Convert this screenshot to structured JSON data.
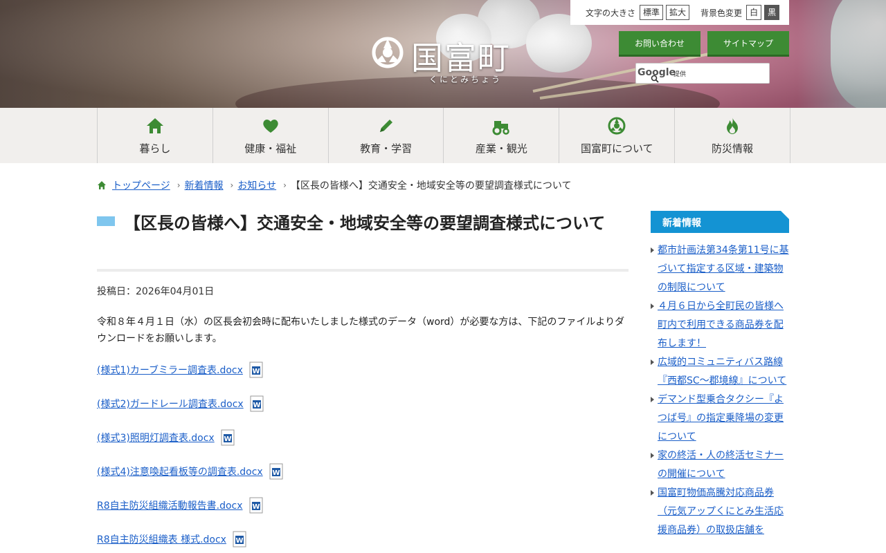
{
  "header": {
    "site_name": "国富町",
    "site_name_kana": "くにとみちょう",
    "text_size_label": "文字の大きさ",
    "text_size_standard": "標準",
    "text_size_large": "拡大",
    "bg_color_label": "背景色変更",
    "bg_white": "白",
    "bg_black": "黒",
    "contact_button": "お問い合わせ",
    "sitemap_button": "サイトマップ",
    "search_brand": "Google",
    "search_sub": "提供"
  },
  "nav": {
    "items": [
      {
        "label": "暮らし",
        "icon": "home-icon"
      },
      {
        "label": "健康・福祉",
        "icon": "heart-icon"
      },
      {
        "label": "教育・学習",
        "icon": "pencil-icon"
      },
      {
        "label": "産業・観光",
        "icon": "tractor-icon"
      },
      {
        "label": "国富町について",
        "icon": "town-emblem-icon"
      },
      {
        "label": "防災情報",
        "icon": "flame-icon"
      }
    ]
  },
  "breadcrumb": {
    "home": "トップページ",
    "level1": "新着情報",
    "level2": "お知らせ",
    "current": "【区長の皆様へ】交通安全・地域安全等の要望調査様式について"
  },
  "article": {
    "title": "【区長の皆様へ】交通安全・地域安全等の要望調査様式について",
    "posted": "投稿日：2026年04月01日",
    "body": "令和８年４月１日（水）の区長会初会時に配布いたしました様式のデータ（word）が必要な方は、下記のファイルよりダウンロードをお願いします。",
    "files": [
      "(様式1)カーブミラー調査表.docx",
      "(様式2)ガードレール調査表.docx",
      "(様式3)照明灯調査表.docx",
      "(様式4)注意喚起看板等の調査表.docx",
      "R8自主防災組織活動報告書.docx",
      "R8自主防災組織表 様式.docx"
    ]
  },
  "sidebar": {
    "heading": "新着情報",
    "items": [
      "都市計画法第34条第11号に基づいて指定する区域・建築物の制限について",
      "４月６日から全町民の皆様へ町内で利用できる商品券を配布します！",
      "広域的コミュニティバス路線『西都SC～郡境線』について",
      "デマンド型乗合タクシー『よつば号』の指定乗降場の変更について",
      "家の終活・人の終活セミナーの開催について",
      "国富町物価高騰対応商品券（元気アップくにとみ生活応援商品券）の取扱店舗を"
    ]
  },
  "colors": {
    "green_button": "#3d8b34",
    "link": "#1a5ec8",
    "sidebar_head": "#1493d3",
    "title_accent": "#7fc6ee"
  }
}
